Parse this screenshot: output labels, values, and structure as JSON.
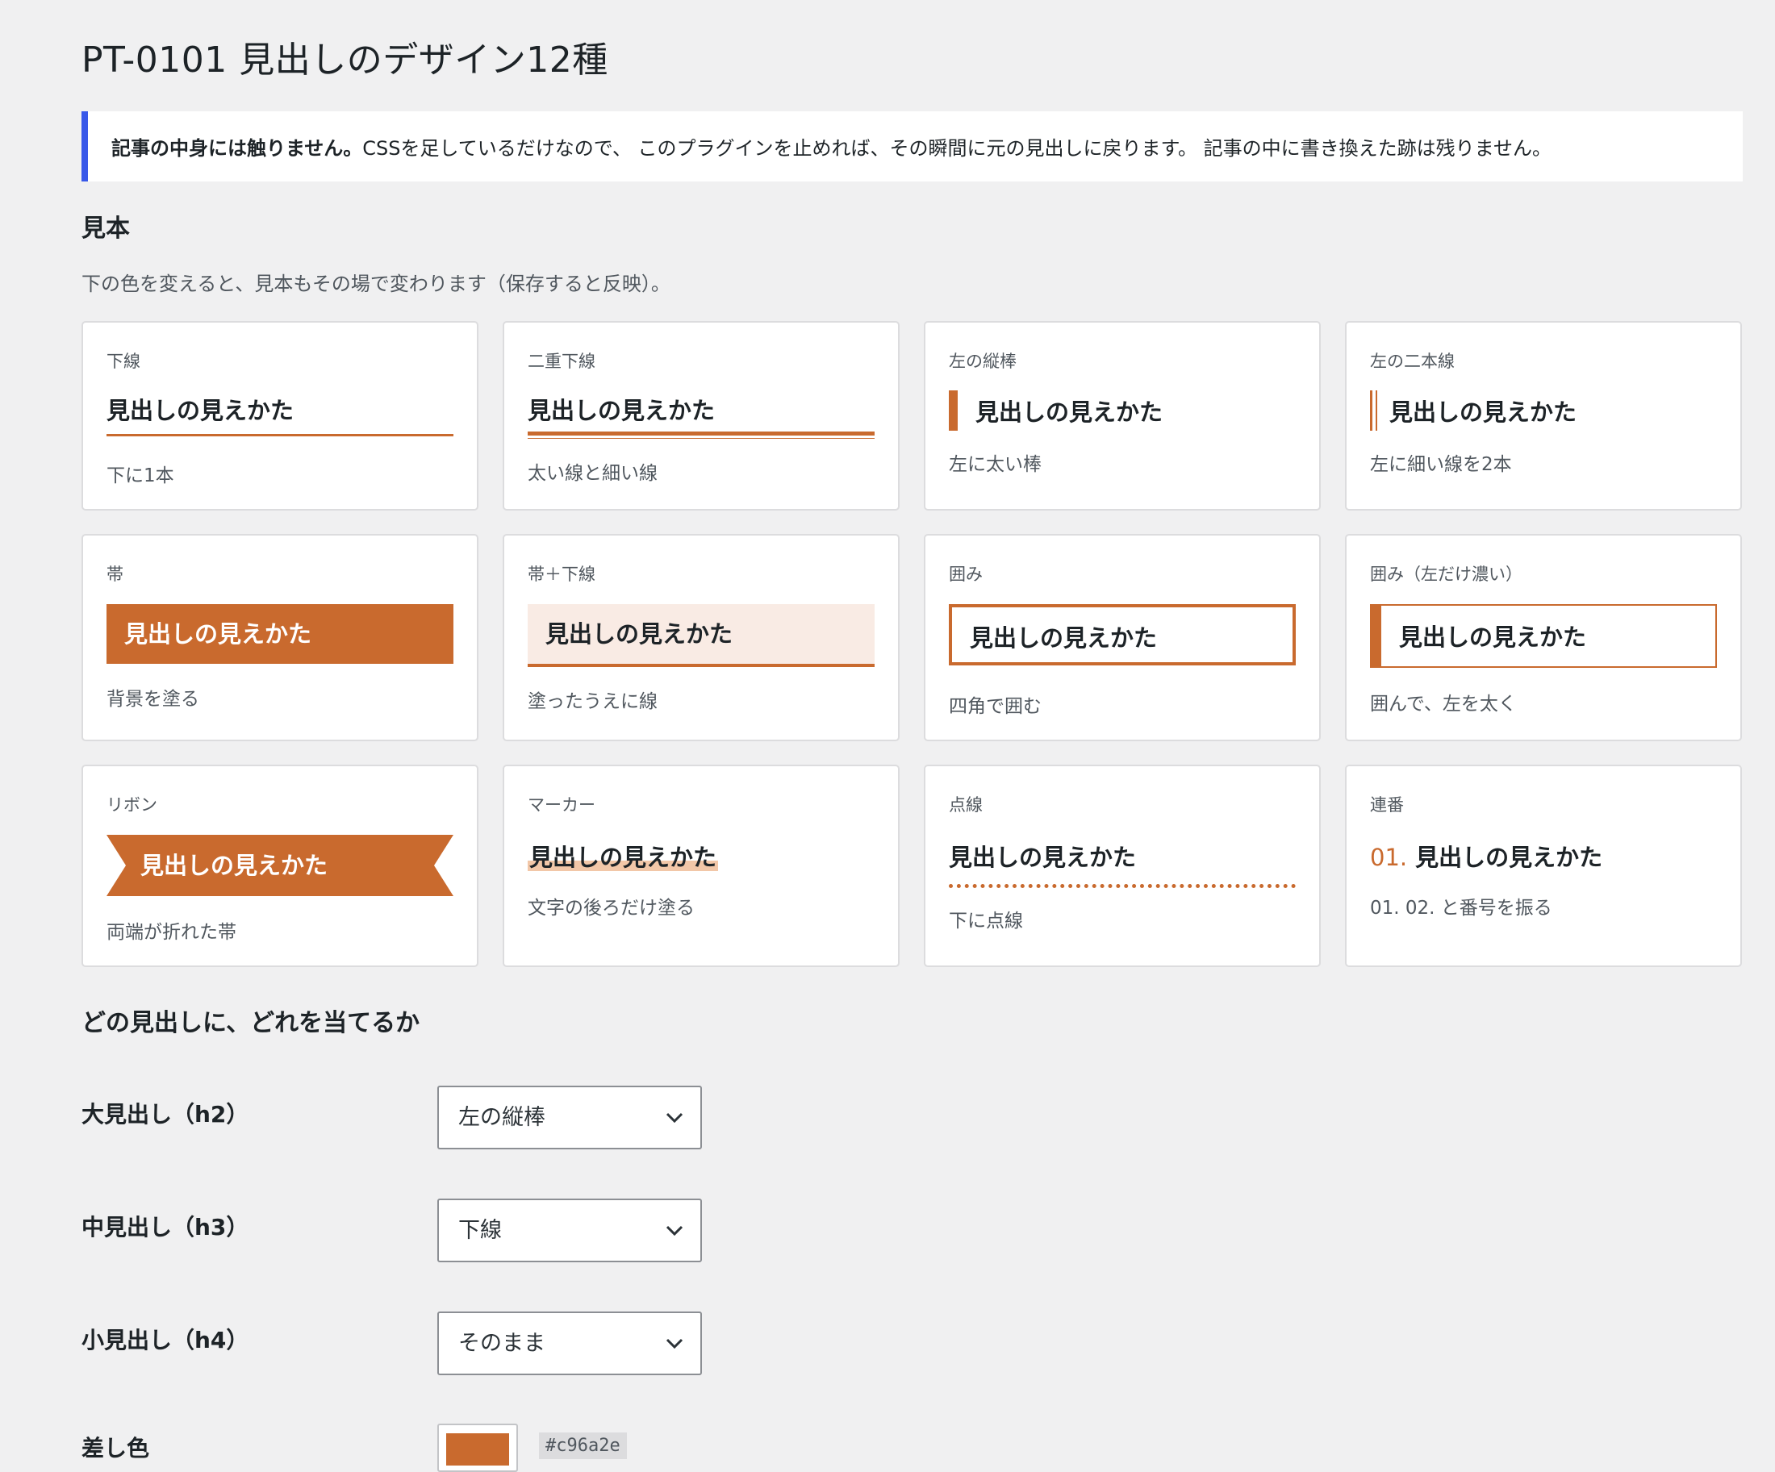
{
  "page": {
    "title": "PT-0101 見出しのデザイン12種"
  },
  "notice": {
    "bold": "記事の中身には触りません。",
    "text": "CSSを足しているだけなので、 このプラグインを止めれば、その瞬間に元の見出しに戻ります。 記事の中に書き換えた跡は残りません。"
  },
  "samples": {
    "title": "見本",
    "description": "下の色を変えると、見本もその場で変わります（保存すると反映）。",
    "heading_text": "見出しの見えかた",
    "number_prefix": "01.",
    "cards": [
      {
        "label": "下線",
        "note": "下に1本"
      },
      {
        "label": "二重下線",
        "note": "太い線と細い線"
      },
      {
        "label": "左の縦棒",
        "note": "左に太い棒"
      },
      {
        "label": "左の二本線",
        "note": "左に細い線を2本"
      },
      {
        "label": "帯",
        "note": "背景を塗る"
      },
      {
        "label": "帯＋下線",
        "note": "塗ったうえに線"
      },
      {
        "label": "囲み",
        "note": "四角で囲む"
      },
      {
        "label": "囲み（左だけ濃い）",
        "note": "囲んで、左を太く"
      },
      {
        "label": "リボン",
        "note": "両端が折れた帯"
      },
      {
        "label": "マーカー",
        "note": "文字の後ろだけ塗る"
      },
      {
        "label": "点線",
        "note": "下に点線"
      },
      {
        "label": "連番",
        "note": "01. 02. と番号を振る"
      }
    ]
  },
  "assign": {
    "title": "どの見出しに、どれを当てるか",
    "rows": [
      {
        "label": "大見出し（h2）",
        "value": "左の縦棒"
      },
      {
        "label": "中見出し（h3）",
        "value": "下線"
      },
      {
        "label": "小見出し（h4）",
        "value": "そのまま"
      }
    ],
    "color_label": "差し色",
    "color_hex": "#c96a2e"
  },
  "colors": {
    "accent": "#c96a2e",
    "notice_border": "#3858e9"
  },
  "icons": {
    "select_arrow": "chevron-down-icon"
  }
}
